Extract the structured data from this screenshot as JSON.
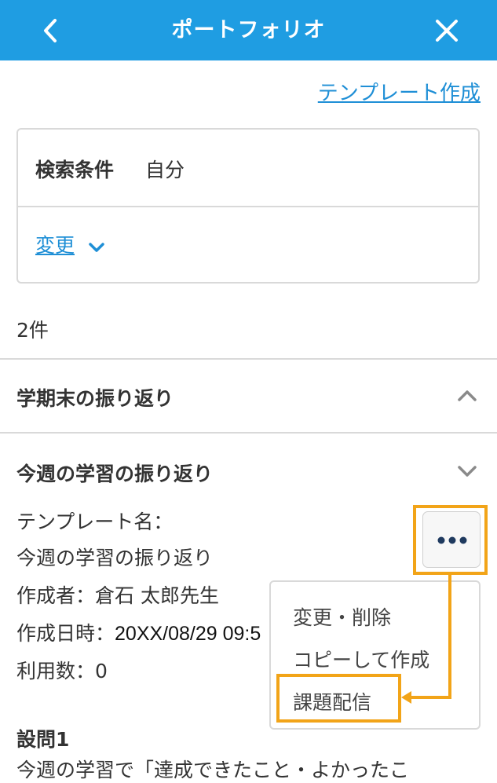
{
  "header": {
    "title": "ポートフォリオ"
  },
  "template_link": "テンプレート作成",
  "search": {
    "label": "検索条件",
    "value": "自分",
    "change_label": "変更"
  },
  "result_count": "2件",
  "sections": [
    {
      "title": "学期末の振り返り",
      "expanded": false
    },
    {
      "title": "今週の学習の振り返り",
      "expanded": true
    }
  ],
  "detail": {
    "template_name_label": "テンプレート名：",
    "template_name_value": "今週の学習の振り返り",
    "creator_label": "作成者：",
    "creator_value": "倉石 太郎先生",
    "created_at_label": "作成日時：",
    "created_at_value": "20XX/08/29 09:5",
    "usage_label": "利用数：",
    "usage_value": "0"
  },
  "menu": {
    "items": [
      "変更・削除",
      "コピーして作成",
      "課題配信"
    ]
  },
  "question": {
    "title": "設問1",
    "text": "今週の学習で「達成できたこと・よかったこ"
  },
  "colors": {
    "header_bg": "#1f9de2",
    "link": "#1f8fd6",
    "highlight": "#f2a418",
    "dots": "#1f3a5f"
  }
}
